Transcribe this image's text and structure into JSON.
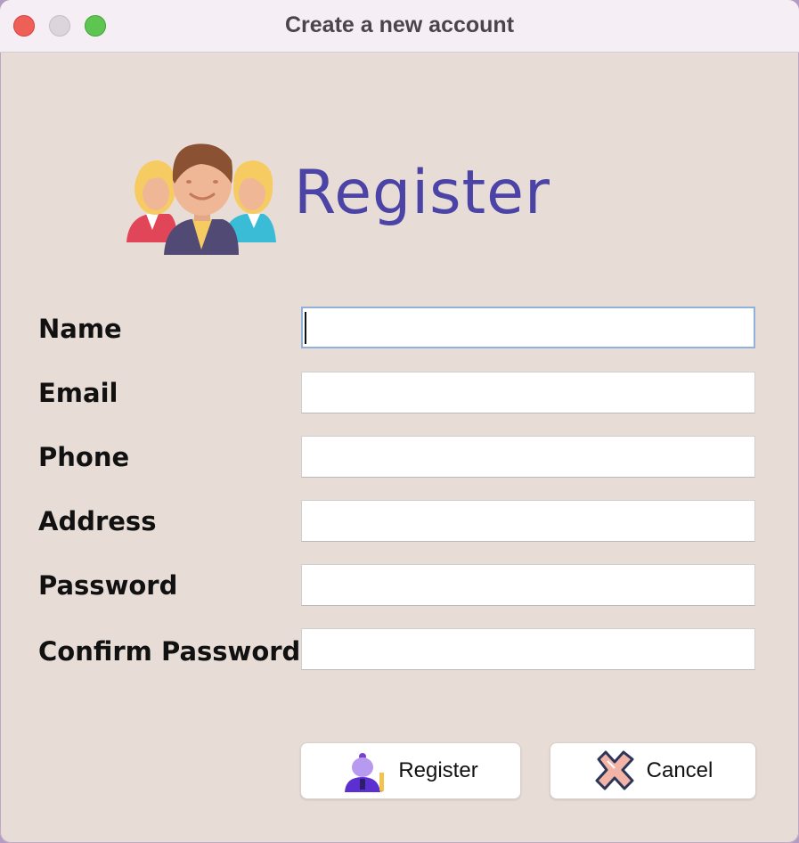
{
  "window": {
    "title": "Create a new account",
    "controls": [
      "close",
      "minimize",
      "maximize"
    ]
  },
  "header": {
    "icon": "users-group-icon",
    "heading": "Register"
  },
  "form": {
    "fields": [
      {
        "label": "Name",
        "value": "",
        "focused": true
      },
      {
        "label": "Email",
        "value": ""
      },
      {
        "label": "Phone",
        "value": ""
      },
      {
        "label": "Address",
        "value": ""
      },
      {
        "label": "Password",
        "value": ""
      },
      {
        "label": "Confirm Password",
        "value": ""
      }
    ]
  },
  "buttons": {
    "register": {
      "label": "Register",
      "icon": "user-edit-icon"
    },
    "cancel": {
      "label": "Cancel",
      "icon": "cross-icon"
    }
  },
  "colors": {
    "background": "#e8ddd6",
    "heading": "#4b44a6",
    "titlebar": "#f6eef5"
  }
}
